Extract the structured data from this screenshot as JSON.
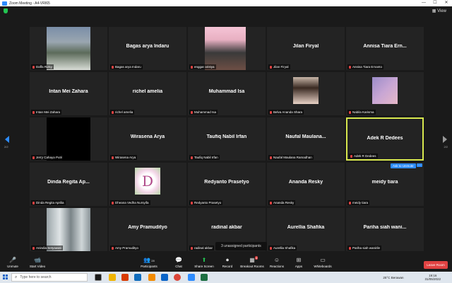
{
  "window": {
    "title": "Zoom Meeting - A4-VRI65",
    "controls": [
      "—",
      "☐",
      "✕"
    ]
  },
  "colors": {
    "accent": "#2d8cff",
    "active_border": "#d8e84e",
    "muted_mic": "#e04242",
    "leave": "#e04242",
    "share": "#23c552"
  },
  "pagination": {
    "left": "2/2",
    "right": "2/2"
  },
  "participants": [
    {
      "name": "",
      "label": "Daffa Rizky",
      "photo": "group"
    },
    {
      "name": "Bagas arya Indaru",
      "label": "Bagas arya Indaru"
    },
    {
      "name": "",
      "label": "enggar aristya",
      "photo": "girl-pink"
    },
    {
      "name": "Jilan Firyal",
      "label": "Jilan Firyal"
    },
    {
      "name": "Annisa Tiara Ern...",
      "label": "Annisa Tiara Ernanto"
    },
    {
      "name": "Intan Mei Zahara",
      "label": "Intan Mei Zahara"
    },
    {
      "name": "richel amelia",
      "label": "richel amelia"
    },
    {
      "name": "Muhammad Isa",
      "label": "Muhammad Isa"
    },
    {
      "name": "",
      "label": "Belva Ananda Shara",
      "photo": "girl-portrait"
    },
    {
      "name": "",
      "label": "Nabila Karisma",
      "photo": "sky"
    },
    {
      "name": "",
      "label": "Jerry Cahaya Putri",
      "photo": "black"
    },
    {
      "name": "Wirasena Arya",
      "label": "Wirasena Arya"
    },
    {
      "name": "Taufiq Nabil Irfan",
      "label": "Taufiq Nabil Irfan"
    },
    {
      "name": "Naufal  Maulana...",
      "label": "Naufal Maulana Ramadhan"
    },
    {
      "name": "Adek R Dedees",
      "label": "Adek R Dedees",
      "active": true
    },
    {
      "name": "Dinda Regita Ap...",
      "label": "Dinda Regita Aprilia"
    },
    {
      "name": "",
      "label": "Dheana Vedha Nursyifa",
      "photo": "letter-d"
    },
    {
      "name": "Redyanto Prasetyo",
      "label": "Redyanto Prasetyo"
    },
    {
      "name": "Ananda Resky",
      "label": "Ananda Resky"
    },
    {
      "name": "meidy tiara",
      "label": "meidy tiara"
    },
    {
      "name": "",
      "label": "Anindia Setyawati",
      "photo": "stairs"
    },
    {
      "name": "Amy Pramudityo",
      "label": "Amy Pramudityo"
    },
    {
      "name": "radinal akbar",
      "label": "radinal akbar"
    },
    {
      "name": "Aurellia Shafika",
      "label": "Aurellia Shafika"
    },
    {
      "name": "Pariha siah wani...",
      "label": "Pariha siah wanirile"
    }
  ],
  "ask_to_unmute": "Ask to Unmute",
  "more": "···",
  "unassigned": "3 unassigned participants",
  "toolbar": {
    "unmute": "Unmute",
    "start_video": "Start Video",
    "participants": "Participants",
    "participants_count": "28",
    "chat": "Chat",
    "share_screen": "Share Screen",
    "record": "Record",
    "breakout_rooms": "Breakout Rooms",
    "breakout_badge": "4",
    "reactions": "Reactions",
    "apps": "Apps",
    "whiteboards": "Whiteboards",
    "leave": "Leave Room"
  },
  "taskbar": {
    "search_placeholder": "Type here to search",
    "weather": "25°C  Berawan",
    "time": "19:16",
    "date": "31/05/2022"
  }
}
